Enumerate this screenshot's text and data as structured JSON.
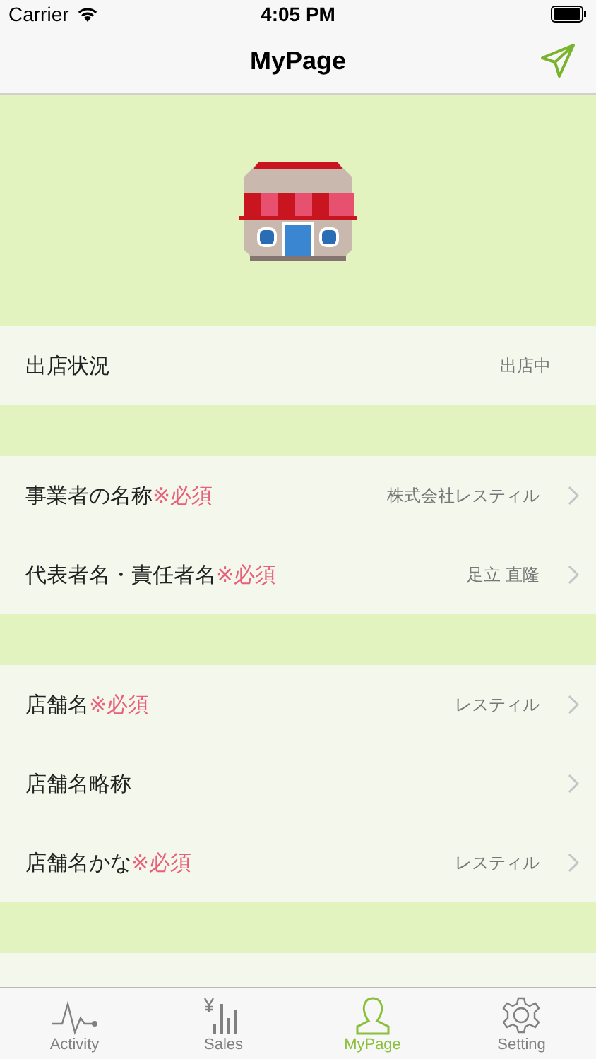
{
  "status_bar": {
    "carrier": "Carrier",
    "time": "4:05 PM"
  },
  "nav": {
    "title": "MyPage"
  },
  "sections": [
    {
      "rows": [
        {
          "label": "出店状況",
          "value": "出店中",
          "chevron": false
        }
      ]
    },
    {
      "rows": [
        {
          "label": "事業者の名称",
          "required_mark": "※必須",
          "value": "株式会社レスティル",
          "chevron": true
        },
        {
          "label": "代表者名・責任者名",
          "required_mark": "※必須",
          "value": "足立 直隆",
          "chevron": true
        }
      ]
    },
    {
      "rows": [
        {
          "label": "店舗名",
          "required_mark": "※必須",
          "value": "レスティル",
          "chevron": true
        },
        {
          "label": "店舗名略称",
          "chevron": true
        },
        {
          "label": "店舗名かな",
          "required_mark": "※必須",
          "value": "レスティル",
          "chevron": true
        }
      ]
    }
  ],
  "tabs": [
    {
      "label": "Activity",
      "kind": "activity",
      "selected": false
    },
    {
      "label": "Sales",
      "kind": "sales",
      "selected": false
    },
    {
      "label": "MyPage",
      "kind": "person",
      "selected": true
    },
    {
      "label": "Setting",
      "kind": "gear",
      "selected": false
    }
  ]
}
